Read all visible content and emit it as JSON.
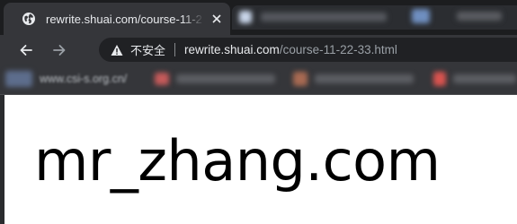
{
  "tabs": {
    "active": {
      "title": "rewrite.shuai.com/course-11-2",
      "favicon": "globe-icon"
    }
  },
  "toolbar": {
    "back_icon": "arrow-left-icon",
    "forward_icon": "arrow-right-icon",
    "security_icon": "warning-triangle-icon",
    "security_label": "不安全",
    "url_host": "rewrite.shuai.com",
    "url_path": "/course-11-22-33.html"
  },
  "bookmarks": {
    "first_label": "www.csi-s.org.cn/"
  },
  "page": {
    "heading": "mr_zhang.com"
  },
  "colors": {
    "tab_active_bg": "#35363a",
    "tabstrip_bg": "#1c1d1f",
    "omnibox_bg": "#202124",
    "page_bg": "#ffffff",
    "heading_color": "#000000"
  }
}
